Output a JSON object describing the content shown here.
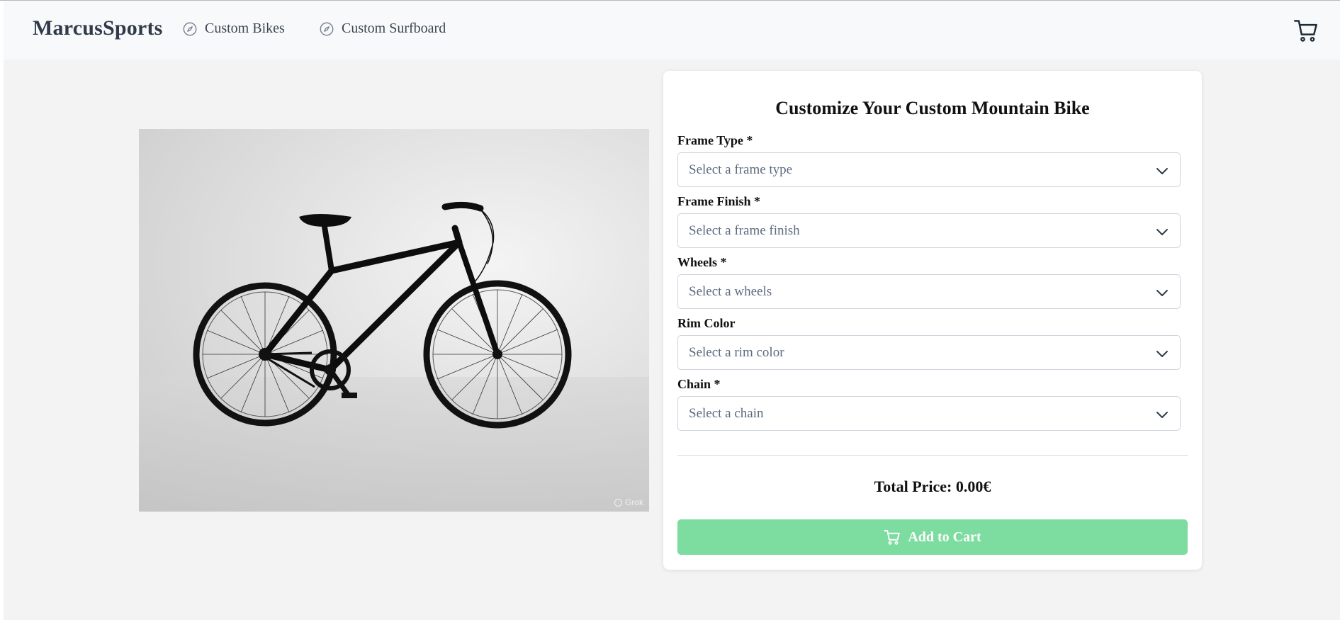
{
  "header": {
    "brand": "MarcusSports",
    "nav": [
      {
        "label": "Custom Bikes",
        "icon": "compass-icon"
      },
      {
        "label": "Custom Surfboard",
        "icon": "compass-icon"
      }
    ],
    "cart_icon": "cart-icon"
  },
  "product": {
    "image_alt": "black city bike on grey studio background",
    "watermark": "Grok"
  },
  "configurator": {
    "title": "Customize Your Custom Mountain Bike",
    "fields": [
      {
        "label": "Frame Type *",
        "placeholder": "Select a frame type"
      },
      {
        "label": "Frame Finish *",
        "placeholder": "Select a frame finish"
      },
      {
        "label": "Wheels *",
        "placeholder": "Select a wheels"
      },
      {
        "label": "Rim Color",
        "placeholder": "Select a rim color"
      },
      {
        "label": "Chain *",
        "placeholder": "Select a chain"
      }
    ],
    "total_price": "Total Price: 0.00€",
    "add_to_cart": "Add to Cart"
  },
  "colors": {
    "brand_text": "#2f3a4a",
    "add_button": "#7ddc9f",
    "page_bg": "#f3f3f3"
  }
}
